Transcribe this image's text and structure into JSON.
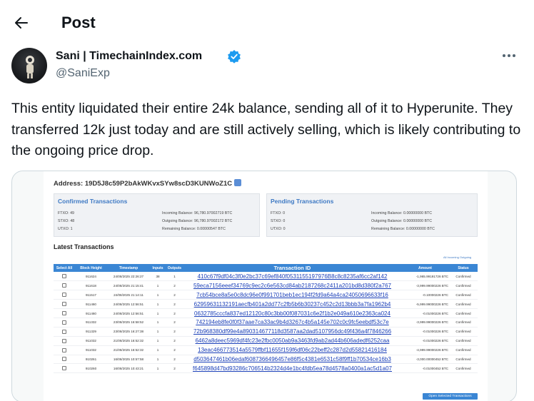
{
  "header": {
    "title": "Post",
    "back_icon": "arrow-left-icon"
  },
  "author": {
    "name": "Sani | TimechainIndex.com",
    "handle": "@SaniExp",
    "verified_color": "#1d9bf0"
  },
  "post": {
    "text": "This entity liquidated their entire 24k balance, sending all of it to Hyperunite. They transferred 12k just today and are still actively selling, which is likely contributing to the ongoing price drop."
  },
  "media": {
    "address_label": "Address: 19D5J8c59P2bAkWKvxSYw8scD3KUNWoZ1C",
    "confirmed": {
      "title": "Confirmed Transactions",
      "ftxo": "FTXO: 49",
      "stxo": "STXO: 48",
      "utxo": "UTXO: 1",
      "incoming": "Incoming Balance: 96,780.97002719 BTC",
      "outgoing": "Outgoing Balance: 96,780.97002172 BTC",
      "remaining": "Remaining Balance: 0.00000547 BTC"
    },
    "pending": {
      "title": "Pending Transactions",
      "ftxo": "FTXO: 0",
      "stxo": "STXO: 0",
      "utxo": "UTXO: 0",
      "incoming": "Incoming Balance: 0.00000000 BTC",
      "outgoing": "Outgoing Balance: 0.00000000 BTC",
      "remaining": "Remaining Balance: 0.00000000 BTC"
    },
    "latest_title": "Latest Transactions",
    "legend": "All  Incoming  Outgoing",
    "columns": [
      "Select All",
      "Block Height",
      "Timestamp",
      "Inputs",
      "Outputs",
      "Transaction ID",
      "Amount",
      "Status"
    ],
    "rows": [
      {
        "block": "911624",
        "ts": "24/08/2025 22:26:27",
        "in": "38",
        "out": "1",
        "txid": "410c67f9df04c3f0e2bc37c69ef840f0531155197976B8c8c8235af6cc2af142",
        "amount": "-1,965.99191726 BTC",
        "status": "Confirmed"
      },
      {
        "block": "911618",
        "ts": "24/08/2025 21:15:41",
        "in": "1",
        "out": "2",
        "txid": "59eca7156eeef34769c9ec2c6e563cd84ab2187268c2411a201bd8d380f2a767",
        "amount": "-3,999.99000226 BTC",
        "status": "Confirmed"
      },
      {
        "block": "911517",
        "ts": "24/08/2025 21:14:11",
        "in": "1",
        "out": "2",
        "txid": "7cb54bce8a5e0c8dc96e0f991701beb1ec194f2fd9a64a4ca24050696633f16",
        "amount": "-0.10000226 BTC",
        "status": "Confirmed"
      },
      {
        "block": "911460",
        "ts": "24/08/2025 12:56:51",
        "in": "1",
        "out": "2",
        "txid": "62959631132191aecfb401a2dd77c2fb5b6b30237c452c2d13bbb3a7fa1962b4",
        "amount": "-5,999.99000226 BTC",
        "status": "Confirmed"
      },
      {
        "block": "911460",
        "ts": "24/08/2025 12:56:51",
        "in": "1",
        "out": "2",
        "txid": "0632785cccfa837ed12120c80c3bb00f087031c6e2f1b2e049a610e2363ca024",
        "amount": "-0.01000226 BTC",
        "status": "Confirmed"
      },
      {
        "block": "911332",
        "ts": "23/08/2025 16:58:52",
        "in": "1",
        "out": "2",
        "txid": "742194eb8fe0f0f37aae7ca33ac9b4d3267c4b5a145e702c0c9fc5eebdf53c7e",
        "amount": "-3,999.99000226 BTC",
        "status": "Confirmed"
      },
      {
        "block": "911329",
        "ts": "23/08/2025 16:27:38",
        "in": "1",
        "out": "2",
        "txid": "72b968380df99e4a890314677118d3587aa2dad5107956dc49f436a4f7846266",
        "amount": "-0.01000226 BTC",
        "status": "Confirmed"
      },
      {
        "block": "911032",
        "ts": "21/08/2025 16:52:32",
        "in": "1",
        "out": "2",
        "txid": "6462a8deec5969df4fc23e2fbc0050ab9a3463fd9ab2ad44b606adedf6252caa",
        "amount": "-0.01000226 BTC",
        "status": "Confirmed"
      },
      {
        "block": "911032",
        "ts": "21/08/2025 16:52:32",
        "in": "1",
        "out": "2",
        "txid": "13eac466773514a5579ffbf11655f159f6df06c22beff2c287d2d55821416184",
        "amount": "-4,999.99000226 BTC",
        "status": "Confirmed"
      },
      {
        "block": "910261",
        "ts": "16/08/2025 10:57:58",
        "in": "1",
        "out": "2",
        "txid": "d503647461b06edaf6087366496457e86f5c4381e6531c58f9ff1b70534ce16b3",
        "amount": "-3,000.00000452 BTC",
        "status": "Confirmed"
      },
      {
        "block": "910260",
        "ts": "16/08/2025 10:43:21",
        "in": "1",
        "out": "2",
        "txid": "f645898d47bd93286c706514b2324d4e1bc4fdb5ea78d4578a0400a1ac5d1a07",
        "amount": "-0.01000452 BTC",
        "status": "Confirmed"
      }
    ],
    "open_button": "Open Selected Transactions"
  }
}
